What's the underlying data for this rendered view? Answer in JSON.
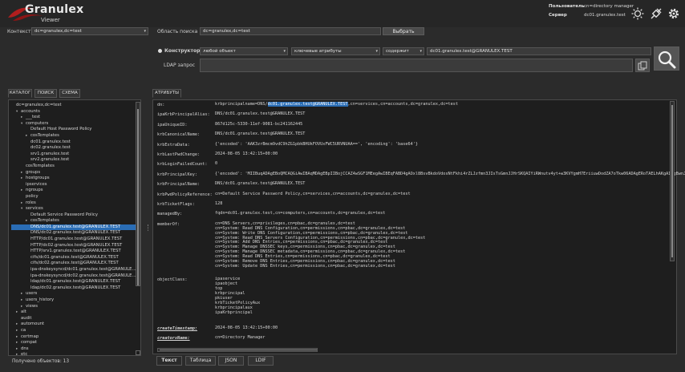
{
  "app": {
    "name": "Granulex",
    "subtitle": "Viewer"
  },
  "user": {
    "user_label": "Пользователь",
    "user_value": "cn=directory manager",
    "server_label": "Сервер",
    "server_value": "dc01.granulex.test"
  },
  "context": {
    "label": "Контекст",
    "value": "dc=granulex,dc=test"
  },
  "search_area": {
    "label": "Область поиска",
    "value": "dc=granulex,dc=test",
    "choose_button": "Выбрать"
  },
  "constructor": {
    "label": "Конструктор",
    "object_type": "любой объект",
    "attributes": "ключевые атрибуты",
    "operator": "содержит",
    "query_value": "dc01.granulex.test@GRANULEX.TEST"
  },
  "ldap": {
    "label": "LDAP запрос",
    "value": ""
  },
  "left_tabs": [
    "КАТАЛОГ",
    "ПОИСК",
    "СХЕМА"
  ],
  "tree": [
    {
      "text": "dc=granulex,dc=test",
      "indent": 0,
      "arrow": ""
    },
    {
      "text": "accounts",
      "indent": 1,
      "arrow": "▾"
    },
    {
      "text": "___test",
      "indent": 2,
      "arrow": "▸"
    },
    {
      "text": "computers",
      "indent": 2,
      "arrow": "▾"
    },
    {
      "text": "Default Host Password Policy",
      "indent": 3,
      "arrow": ""
    },
    {
      "text": "cosTemplates",
      "indent": 3,
      "arrow": "▸"
    },
    {
      "text": "dc01.granulex.test",
      "indent": 3,
      "arrow": ""
    },
    {
      "text": "dc02.granulex.test",
      "indent": 3,
      "arrow": ""
    },
    {
      "text": "srv1.granulex.test",
      "indent": 3,
      "arrow": ""
    },
    {
      "text": "srv2.granulex.test",
      "indent": 3,
      "arrow": ""
    },
    {
      "text": "cosTemplates",
      "indent": 2,
      "arrow": ""
    },
    {
      "text": "groups",
      "indent": 2,
      "arrow": "▸"
    },
    {
      "text": "hostgroups",
      "indent": 2,
      "arrow": "▸"
    },
    {
      "text": "ipservices",
      "indent": 2,
      "arrow": ""
    },
    {
      "text": "ngroups",
      "indent": 2,
      "arrow": "▸"
    },
    {
      "text": "policy",
      "indent": 2,
      "arrow": ""
    },
    {
      "text": "roles",
      "indent": 2,
      "arrow": "▸"
    },
    {
      "text": "services",
      "indent": 2,
      "arrow": "▾"
    },
    {
      "text": "Default Service Password Policy",
      "indent": 3,
      "arrow": ""
    },
    {
      "text": "cosTemplates",
      "indent": 3,
      "arrow": "▸"
    },
    {
      "text": "DNS/dc01.granulex.test@GRANULEX.TEST",
      "indent": 3,
      "arrow": "",
      "selected": true
    },
    {
      "text": "DNS/dc02.granulex.test@GRANULEX.TEST",
      "indent": 3,
      "arrow": ""
    },
    {
      "text": "HTTP/dc01.granulex.test@GRANULEX.TEST",
      "indent": 3,
      "arrow": ""
    },
    {
      "text": "HTTP/dc02.granulex.test@GRANULEX.TEST",
      "indent": 3,
      "arrow": ""
    },
    {
      "text": "HTTP/srv1.granulex.test@GRANULEX.TEST",
      "indent": 3,
      "arrow": ""
    },
    {
      "text": "cifs/dc01.granulex.test@GRANULEX.TEST",
      "indent": 3,
      "arrow": ""
    },
    {
      "text": "cifs/dc02.granulex.test@GRANULEX.TEST",
      "indent": 3,
      "arrow": ""
    },
    {
      "text": "ipa-dnskeysyncd/dc01.granulex.test@GRANULE...",
      "indent": 3,
      "arrow": ""
    },
    {
      "text": "ipa-dnskeysyncd/dc02.granulex.test@GRANULE...",
      "indent": 3,
      "arrow": ""
    },
    {
      "text": "ldap/dc01.granulex.test@GRANULEX.TEST",
      "indent": 3,
      "arrow": ""
    },
    {
      "text": "ldap/dc02.granulex.test@GRANULEX.TEST",
      "indent": 3,
      "arrow": ""
    },
    {
      "text": "users",
      "indent": 2,
      "arrow": "▸"
    },
    {
      "text": "users_history",
      "indent": 2,
      "arrow": "▸"
    },
    {
      "text": "views",
      "indent": 2,
      "arrow": "▸"
    },
    {
      "text": "alt",
      "indent": 1,
      "arrow": "▸"
    },
    {
      "text": "audit",
      "indent": 1,
      "arrow": ""
    },
    {
      "text": "automount",
      "indent": 1,
      "arrow": "▸"
    },
    {
      "text": "ca",
      "indent": 1,
      "arrow": "▸"
    },
    {
      "text": "certmap",
      "indent": 1,
      "arrow": "▸"
    },
    {
      "text": "compat",
      "indent": 1,
      "arrow": "▸"
    },
    {
      "text": "dns",
      "indent": 1,
      "arrow": "▸"
    },
    {
      "text": "etc",
      "indent": 1,
      "arrow": "▸"
    }
  ],
  "status": "Получено объектов: 13",
  "right_tab": "АТРИБУТЫ",
  "attributes": [
    {
      "key": "dn:",
      "lines": [
        "krbprincipalname=DNS/dc01.granulex.test@GRANULEX.TEST,cn=services,cn=accounts,dc=granulex,dc=test"
      ],
      "highlight": "dc01.granulex.test@GRANULEX.TEST"
    },
    {
      "key": "ipaKrbPrincipalAlias:",
      "lines": [
        "DNS/dc01.granulex.test@GRANULEX.TEST"
      ]
    },
    {
      "key": "ipaUniqueID:",
      "lines": [
        "867d125c-5330-11ef-9081-bc241162445"
      ]
    },
    {
      "key": "krbCanonicalName:",
      "lines": [
        "DNS/dc01.granulex.test@GRANULEX.TEST"
      ]
    },
    {
      "key": "krbExtraData:",
      "lines": [
        "{'encoded': 'AAK3zrBmcm9vdC9hZG1pbkBHUkFOVUxFWC5URVNUAA==', 'encoding': 'base64'}"
      ]
    },
    {
      "key": "krbLastPwdChange:",
      "lines": [
        "2024-08-05 13:42:15+00:00"
      ]
    },
    {
      "key": "krbLoginFailedCount:",
      "lines": [
        "0"
      ]
    },
    {
      "key": "krbPrincipalKey:",
      "lines": [
        "{'encoded': 'MIIBuqADAgEBoQMCAQGiAwIBAqMDAgEBpIIBojCCAZ4wSGF1MEegAwIBEqFABD4gAOxl8BsvBkdoVdosNtFkhi4rZLJzfmn3JIsTsGmnJJHrSKQAIYiRWnutv4yt+w3KVYgmH7EriiuwDodZA7oTkw06ADAgERoTAELhAKgAIPgBwnJaMDHsyn...']"
      ]
    },
    {
      "key": "krbPrincipalName:",
      "lines": [
        "DNS/dc01.granulex.test@GRANULEX.TEST"
      ]
    },
    {
      "key": "krbPwdPolicyReference:",
      "lines": [
        "cn=Default Service Password Policy,cn=services,cn=accounts,dc=granulex,dc=test"
      ]
    },
    {
      "key": "krbTicketFlags:",
      "lines": [
        "128"
      ]
    },
    {
      "key": "managedBy:",
      "lines": [
        "fqdn=dc01.granulex.test,cn=computers,cn=accounts,dc=granulex,dc=test"
      ]
    },
    {
      "key": "memberOf:",
      "lines": [
        "cn=DNS Servers,cn=privileges,cn=pbac,dc=granulex,dc=test",
        "cn=System: Read DNS Configuration,cn=permissions,cn=pbac,dc=granulex,dc=test",
        "cn=System: Write DNS Configuration,cn=permissions,cn=pbac,dc=granulex,dc=test",
        "cn=System: Read DNS Servers Configuration,cn=permissions,cn=pbac,dc=granulex,dc=test",
        "cn=System: Add DNS Entries,cn=permissions,cn=pbac,dc=granulex,dc=test",
        "cn=System: Manage DNSSEC keys,cn=permissions,cn=pbac,dc=granulex,dc=test",
        "cn=System: Manage DNSSEC metadata,cn=permissions,cn=pbac,dc=granulex,dc=test",
        "cn=System: Read DNS Entries,cn=permissions,cn=pbac,dc=granulex,dc=test",
        "cn=System: Remove DNS Entries,cn=permissions,cn=pbac,dc=granulex,dc=test",
        "cn=System: Update DNS Entries,cn=permissions,cn=pbac,dc=granulex,dc=test"
      ]
    },
    {
      "key": "objectClass:",
      "lines": [
        "ipaservice",
        "ipaobject",
        "top",
        "krbprincipal",
        "pkiuser",
        "krbTicketPolicyAux",
        "krbprincipalaux",
        "ipaKrbprincipal"
      ]
    },
    {
      "key": "createTimestamp:",
      "lines": [
        "2024-08-05 13:42:15+00:00"
      ],
      "italic": true
    },
    {
      "key": "creatorsName:",
      "lines": [
        "cn=Directory Manager"
      ],
      "italic": true
    }
  ],
  "bottom_tabs": [
    "Текст",
    "Таблица",
    "JSON",
    "LDIF"
  ],
  "icons": {
    "theme": "sun-icon",
    "connect": "plug-icon",
    "settings": "gear-icon",
    "search": "magnifier-icon",
    "copy": "copy-icon"
  }
}
